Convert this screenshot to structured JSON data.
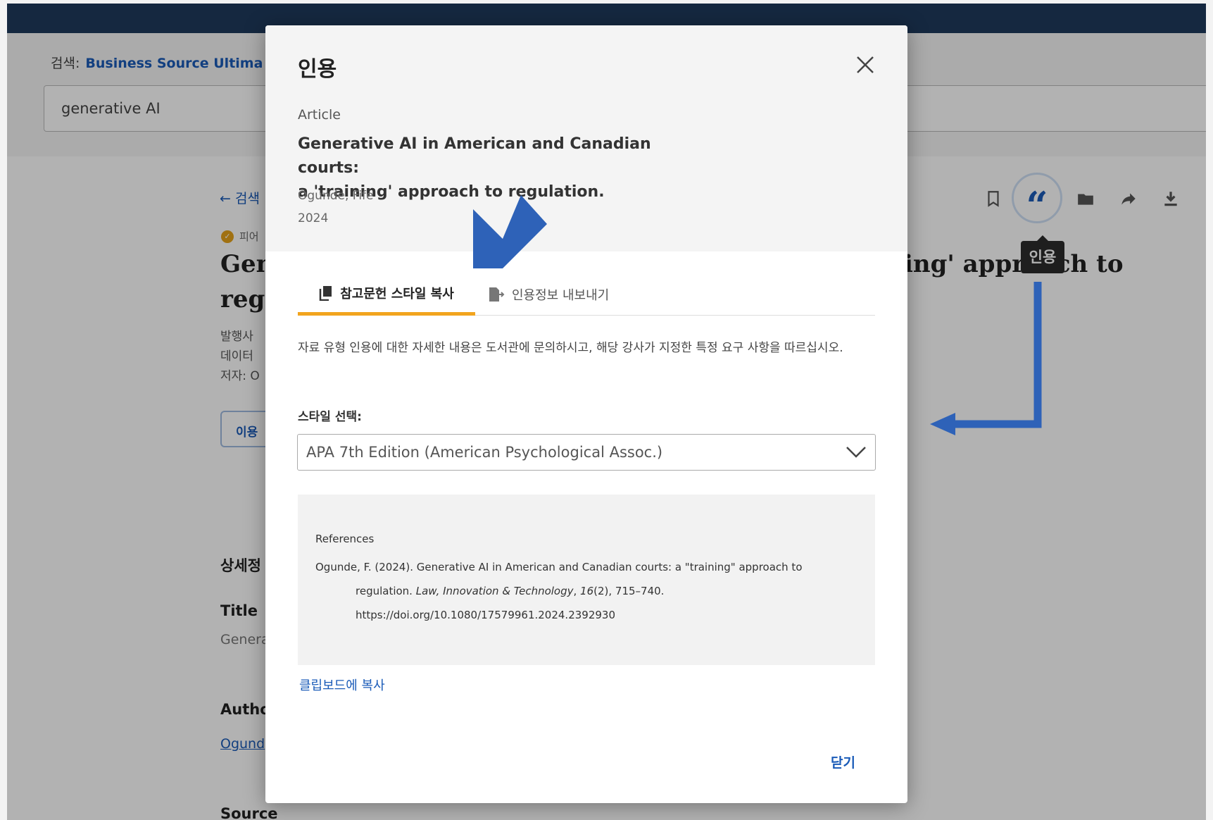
{
  "background": {
    "search_label": "검색:",
    "database": "Business Source Ultima",
    "search_query": "generative AI",
    "back_link": "← 검색",
    "peer_reviewed": "피어",
    "title_fragment_1": "Gen",
    "title_fragment_2": "regu",
    "title_fragment_right": "ing' approach to",
    "meta_publisher": "발행사",
    "meta_database": "데이터",
    "meta_author": "저자: O",
    "cite_btn_fragment": "이용",
    "section_detail": "상세정",
    "section_title": "Title",
    "value_title": "Genera",
    "section_author": "Autho",
    "value_author": "Ogund",
    "section_source": "Source",
    "tooltip": "인용",
    "toolbar_icons": [
      "bookmark-icon",
      "quote-icon",
      "folder-icon",
      "share-icon",
      "download-icon"
    ]
  },
  "modal": {
    "title": "인용",
    "doc_type": "Article",
    "doc_title_line1": "Generative AI in American and Canadian courts:",
    "doc_title_line2": "a 'training' approach to regulation.",
    "author": "Ogunde, Fife",
    "year": "2024",
    "tab_copy": "참고문헌 스타일 복사",
    "tab_export": "인용정보 내보내기",
    "info_text": "자료 유형 인용에 대한 자세한 내용은 도서관에 문의하시고, 해당 강사가 지정한 특정 요구 사항을 따르십시오.",
    "style_label": "스타일 선택:",
    "style_value": "APA 7th Edition (American Psychological Assoc.)",
    "ref_heading": "References",
    "ref_line1": "Ogunde, F. (2024). Generative AI in American and Canadian courts: a \"training\" approach to",
    "ref_line2a": "regulation. ",
    "ref_journal": "Law, Innovation & Technology",
    "ref_line2b": ", ",
    "ref_volume": "16",
    "ref_line2c": "(2), 715–740.",
    "ref_doi": "https://doi.org/10.1080/17579961.2024.2392930",
    "copy_link": "클립보드에 복사",
    "close_link": "닫기"
  },
  "colors": {
    "accent_blue": "#1a5bb8",
    "tab_underline": "#f2a41e",
    "annotation_arrow": "#2e62b8",
    "topbar": "#1f3a5c"
  }
}
